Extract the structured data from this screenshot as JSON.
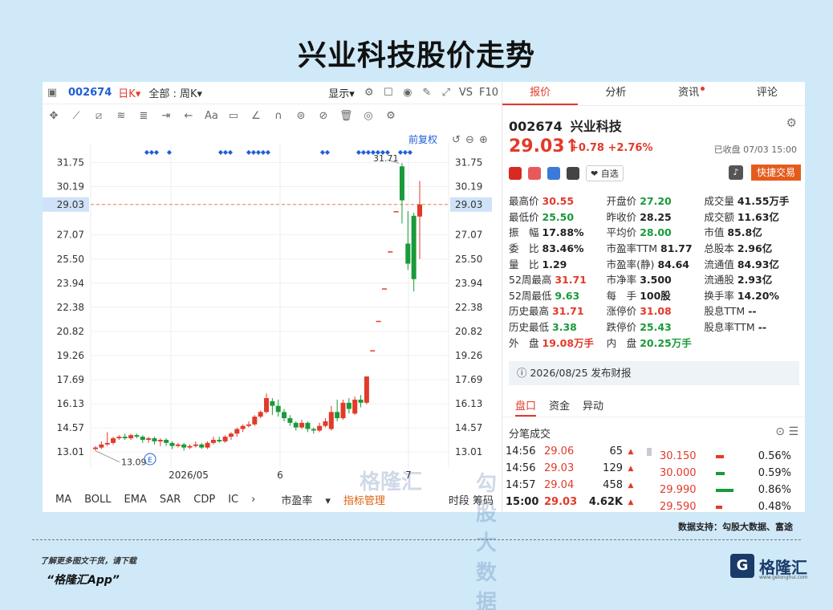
{
  "page_title": "兴业科技股价走势",
  "toolbar": {
    "code": "002674",
    "period": "日K",
    "period_arrow": "▾",
    "scope": "全部 : 周K",
    "scope_arrow": "▾",
    "show": "显示",
    "show_arrow": "▾",
    "vs": "VS",
    "f10": "F10",
    "fuquan": "前复权"
  },
  "chart_data": {
    "type": "candlestick",
    "y_ticks": [
      "31.75",
      "30.19",
      "29.03",
      "27.07",
      "25.50",
      "23.94",
      "22.38",
      "20.82",
      "19.26",
      "17.69",
      "16.13",
      "14.57",
      "13.01"
    ],
    "x_ticks": [
      "2026/05",
      "6",
      "7"
    ],
    "current_price": "29.03",
    "high_label": "31.71",
    "low_label": "13.09",
    "event_marker": "E",
    "ylim": [
      12.5,
      32.5
    ],
    "candles": [
      [
        13.2,
        13.3,
        13.1,
        13.4
      ],
      [
        13.3,
        13.5,
        13.2,
        13.7
      ],
      [
        13.5,
        13.6,
        13.4,
        14.3
      ],
      [
        13.6,
        13.9,
        13.5,
        14.0
      ],
      [
        13.9,
        14.0,
        13.8,
        14.1
      ],
      [
        14.0,
        13.9,
        13.8,
        14.2
      ],
      [
        13.9,
        14.1,
        13.8,
        14.2
      ],
      [
        14.1,
        14.0,
        13.9,
        14.2
      ],
      [
        14.0,
        13.8,
        13.6,
        14.1
      ],
      [
        13.8,
        13.9,
        13.6,
        14.0
      ],
      [
        13.9,
        13.7,
        13.5,
        14.0
      ],
      [
        13.7,
        13.8,
        13.4,
        13.9
      ],
      [
        13.8,
        13.6,
        13.4,
        13.9
      ],
      [
        13.6,
        13.4,
        13.2,
        13.7
      ],
      [
        13.4,
        13.5,
        13.3,
        13.6
      ],
      [
        13.5,
        13.3,
        13.1,
        13.6
      ],
      [
        13.3,
        13.4,
        13.2,
        13.5
      ],
      [
        13.4,
        13.5,
        13.3,
        13.7
      ],
      [
        13.5,
        13.3,
        13.2,
        13.6
      ],
      [
        13.3,
        13.6,
        13.2,
        13.7
      ],
      [
        13.6,
        13.8,
        13.5,
        14.0
      ],
      [
        13.8,
        13.7,
        13.6,
        14.0
      ],
      [
        13.7,
        14.0,
        13.6,
        14.1
      ],
      [
        14.0,
        14.2,
        13.8,
        14.3
      ],
      [
        14.2,
        14.5,
        14.0,
        14.6
      ],
      [
        14.5,
        14.7,
        14.3,
        14.8
      ],
      [
        14.7,
        14.8,
        14.6,
        15.0
      ],
      [
        14.8,
        15.3,
        14.7,
        15.4
      ],
      [
        15.3,
        15.6,
        15.2,
        15.7
      ],
      [
        15.6,
        16.5,
        15.5,
        16.8
      ],
      [
        16.3,
        16.0,
        15.4,
        16.5
      ],
      [
        16.0,
        15.6,
        15.3,
        16.4
      ],
      [
        15.6,
        15.2,
        15.0,
        15.8
      ],
      [
        15.2,
        14.9,
        14.7,
        15.4
      ],
      [
        14.9,
        14.6,
        14.4,
        15.0
      ],
      [
        14.6,
        14.9,
        14.5,
        15.1
      ],
      [
        14.9,
        14.5,
        14.3,
        15.0
      ],
      [
        14.5,
        14.4,
        14.2,
        14.6
      ],
      [
        14.4,
        14.7,
        14.3,
        14.9
      ],
      [
        14.7,
        15.0,
        14.6,
        15.2
      ],
      [
        14.5,
        15.6,
        14.4,
        16.0
      ],
      [
        15.6,
        15.2,
        15.0,
        16.4
      ],
      [
        15.2,
        16.2,
        15.1,
        16.4
      ],
      [
        16.2,
        15.8,
        15.5,
        16.5
      ],
      [
        15.5,
        16.4,
        15.4,
        16.6
      ],
      [
        16.4,
        16.2,
        15.9,
        16.7
      ],
      [
        16.2,
        17.9,
        16.1,
        17.9
      ],
      [
        19.6,
        19.6,
        19.6,
        19.6
      ],
      [
        21.5,
        21.5,
        21.5,
        21.5
      ],
      [
        23.6,
        23.6,
        23.6,
        23.6
      ],
      [
        26.0,
        26.0,
        26.0,
        26.0
      ],
      [
        28.6,
        28.6,
        28.6,
        28.6
      ],
      [
        31.5,
        29.3,
        27.8,
        31.71
      ],
      [
        26.5,
        25.2,
        24.8,
        28.6
      ],
      [
        28.3,
        24.2,
        23.4,
        28.5
      ],
      [
        28.25,
        29.03,
        25.5,
        30.55
      ]
    ]
  },
  "draw_tools_label": "Aa",
  "indicators": {
    "items": [
      "MA",
      "BOLL",
      "EMA",
      "SAR",
      "CDP",
      "IC"
    ],
    "more": "›",
    "pe": "市盈率",
    "pe_arrow": "▾",
    "manage": "指标管理",
    "right": "时段 筹码"
  },
  "tabs": [
    "报价",
    "分析",
    "资讯",
    "评论"
  ],
  "stock": {
    "code": "002674",
    "name": "兴业科技",
    "price": "29.03",
    "arrow": "↑",
    "change": "+0.78  +2.76%",
    "closed": "已收盘 07/03 15:00",
    "watch": "❤ 自选",
    "quick_trade": "快捷交易"
  },
  "quote_grid": [
    [
      {
        "l": "最高价",
        "v": "30.55",
        "c": "red"
      },
      {
        "l": "开盘价",
        "v": "27.20",
        "c": "green"
      },
      {
        "l": "成交量",
        "v": "41.55万手",
        "c": "blk"
      }
    ],
    [
      {
        "l": "最低价",
        "v": "25.50",
        "c": "green"
      },
      {
        "l": "昨收价",
        "v": "28.25",
        "c": "blk"
      },
      {
        "l": "成交额",
        "v": "11.63亿",
        "c": "blk"
      }
    ],
    [
      {
        "l": "振　幅",
        "v": "17.88%",
        "c": "blk"
      },
      {
        "l": "平均价",
        "v": "28.00",
        "c": "green"
      },
      {
        "l": "市值",
        "v": "85.8亿",
        "c": "blk"
      }
    ],
    [
      {
        "l": "委　比",
        "v": "83.46%",
        "c": "blk"
      },
      {
        "l": "市盈率TTM",
        "v": "81.77",
        "c": "blk"
      },
      {
        "l": "总股本",
        "v": "2.96亿",
        "c": "blk"
      }
    ],
    [
      {
        "l": "量　比",
        "v": "1.29",
        "c": "blk"
      },
      {
        "l": "市盈率(静)",
        "v": "84.64",
        "c": "blk"
      },
      {
        "l": "流通值",
        "v": "84.93亿",
        "c": "blk"
      }
    ],
    [
      {
        "l": "52周最高",
        "v": "31.71",
        "c": "red"
      },
      {
        "l": "市净率",
        "v": "3.500",
        "c": "blk"
      },
      {
        "l": "流通股",
        "v": "2.93亿",
        "c": "blk"
      }
    ],
    [
      {
        "l": "52周最低",
        "v": "9.63",
        "c": "green"
      },
      {
        "l": "每　手",
        "v": "100股",
        "c": "blk"
      },
      {
        "l": "换手率",
        "v": "14.20%",
        "c": "blk"
      }
    ],
    [
      {
        "l": "历史最高",
        "v": "31.71",
        "c": "red"
      },
      {
        "l": "涨停价",
        "v": "31.08",
        "c": "red"
      },
      {
        "l": "股息TTM",
        "v": "--",
        "c": "blk"
      }
    ],
    [
      {
        "l": "历史最低",
        "v": "3.38",
        "c": "green"
      },
      {
        "l": "跌停价",
        "v": "25.43",
        "c": "green"
      },
      {
        "l": "股息率TTM",
        "v": "--",
        "c": "blk"
      }
    ],
    [
      {
        "l": "外　盘",
        "v": "19.08万手",
        "c": "red"
      },
      {
        "l": "内　盘",
        "v": "20.25万手",
        "c": "green"
      },
      {
        "l": "",
        "v": "",
        "c": "blk"
      }
    ]
  ],
  "notice": "2026/08/25  发布财报",
  "subtabs": [
    "盘口",
    "资金",
    "异动"
  ],
  "trades_title": "分笔成交",
  "trades": [
    {
      "t": "14:56",
      "p": "29.06",
      "v": "65"
    },
    {
      "t": "14:56",
      "p": "29.03",
      "v": "129"
    },
    {
      "t": "14:57",
      "p": "29.04",
      "v": "458"
    },
    {
      "t": "15:00",
      "p": "29.03",
      "v": "4.62K"
    }
  ],
  "orders": [
    {
      "p": "30.150",
      "pct": "0.56%",
      "w": 0.25
    },
    {
      "p": "30.000",
      "pct": "0.59%",
      "w": 0.28
    },
    {
      "p": "29.990",
      "pct": "0.86%",
      "w": 0.55
    },
    {
      "p": "29.590",
      "pct": "0.48%",
      "w": 0.2
    }
  ],
  "watermark_left": "格隆汇",
  "watermark_right": "勾股大数据",
  "source": "数据支持：勾股大数据、富途",
  "download_hint": "了解更多图文干货，请下载",
  "app_name": "“格隆汇App”",
  "logo_text": "格隆汇",
  "logo_sub": "www.gelonghui.com"
}
